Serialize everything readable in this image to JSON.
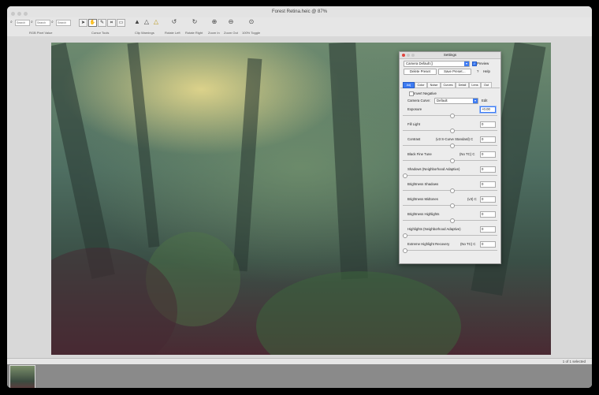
{
  "window": {
    "title": "Forest Retina.heic @ 87%"
  },
  "toolbar": {
    "field1": "Search",
    "field2": "Search",
    "field3": "Search",
    "label_rgb": "RGB Pixel Value",
    "label_cursor": "Cursor Tools",
    "label_clip": "Clip Warnings",
    "label_rotl": "Rotate Left",
    "label_rotr": "Rotate Right",
    "label_zin": "Zoom In",
    "label_zout": "Zoom Out",
    "label_toggle": "100% Toggle"
  },
  "status": {
    "selection": "1 of 1 selected"
  },
  "settings": {
    "title": "Settings",
    "preset": "Camera Default ()",
    "preview_label": "Preview",
    "delete_preset": "Delete Preset",
    "save_preset": "Save Preset…",
    "help": "Help",
    "tabs": [
      "Adj",
      "Color",
      "Noise",
      "Curves",
      "Detail",
      "Lens",
      "Out"
    ],
    "invert_negative": "Invert Negative",
    "camera_curve_label": "Camera Curve:",
    "camera_curve_value": "Default",
    "edit": "Edit",
    "exposure": {
      "label": "Exposure",
      "value": "+0.00"
    },
    "fill_light": {
      "label": "Fill Light",
      "value": "0"
    },
    "contrast": {
      "label": "Contrast",
      "mode": "(v3 S-Curve Standard) C",
      "value": "0"
    },
    "black_fine_tune": {
      "label": "Black Fine Tune",
      "mode": "(No TC) C",
      "value": "0"
    },
    "shadows": {
      "label": "Shadows (Neighborhood Adaptive)",
      "value": "0"
    },
    "brightness_shadows": {
      "label": "Brightness Shadows",
      "value": "0"
    },
    "brightness_midtones": {
      "label": "Brightness Midtones",
      "mode": "(v3) C",
      "value": "0"
    },
    "brightness_highlights": {
      "label": "Brightness Highlights",
      "value": "0"
    },
    "highlights": {
      "label": "Highlights (Neighborhood Adaptive)",
      "value": "0"
    },
    "extreme_highlight": {
      "label": "Extreme Highlight Recovery",
      "mode": "(No TC) C",
      "value": "0"
    }
  }
}
